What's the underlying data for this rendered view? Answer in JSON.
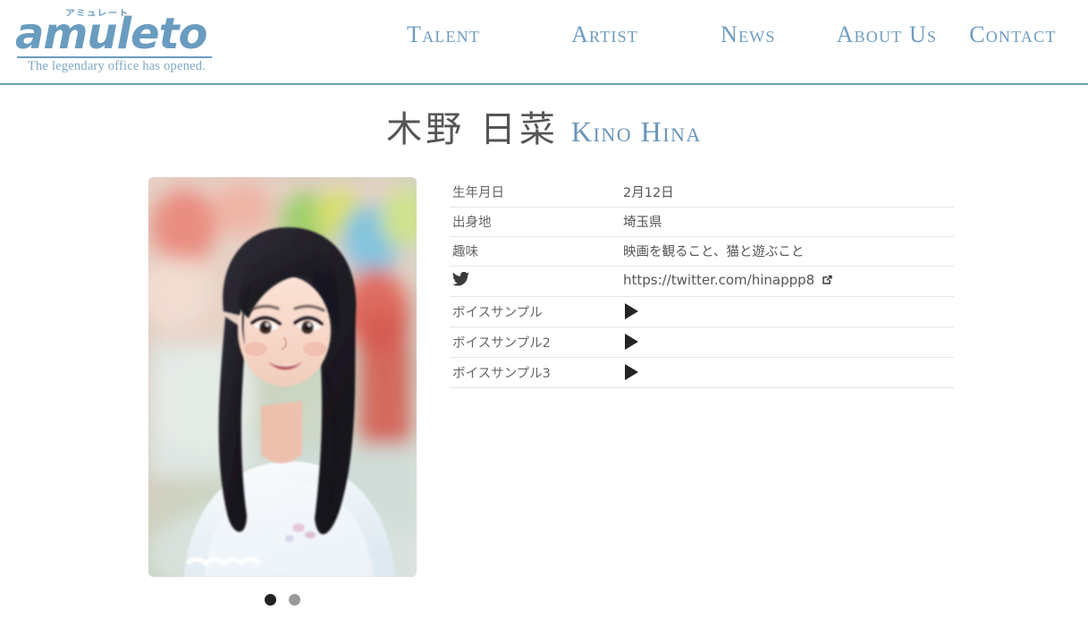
{
  "brand": {
    "logo_kana": "アミュレート",
    "logo_word": "amuleto",
    "tagline": "The legendary office has opened.",
    "logo_color": "#6a9cc0"
  },
  "nav": {
    "items": [
      {
        "label": "Talent",
        "name": "talent"
      },
      {
        "label": "Artist",
        "name": "artist"
      },
      {
        "label": "News",
        "name": "news"
      },
      {
        "label": "About Us",
        "name": "about-us"
      },
      {
        "label": "Contact",
        "name": "contact"
      }
    ],
    "color": "#6e9cc2"
  },
  "page_title": {
    "name_ja": "木野 日菜",
    "name_en": "Kino Hina",
    "en_color": "#6b95b8"
  },
  "photo": {
    "alt": "木野 日菜 profile photo",
    "carousel": {
      "dots": [
        {
          "state": "active",
          "color": "#222222"
        },
        {
          "state": "inactive",
          "color": "#9a9a9a"
        }
      ]
    }
  },
  "profile": {
    "rows": [
      {
        "label": "生年月日",
        "value": "2月12日",
        "type": "text"
      },
      {
        "label": "出身地",
        "value": "埼玉県",
        "type": "text"
      },
      {
        "label": "趣味",
        "value": "映画を観ること、猫と遊ぶこと",
        "type": "text"
      },
      {
        "label": "",
        "icon": "twitter-icon",
        "value": "https://twitter.com/hinappp8",
        "type": "link"
      },
      {
        "label": "ボイスサンプル",
        "value": "",
        "type": "audio"
      },
      {
        "label": "ボイスサンプル2",
        "value": "",
        "type": "audio"
      },
      {
        "label": "ボイスサンプル3",
        "value": "",
        "type": "audio"
      }
    ]
  }
}
